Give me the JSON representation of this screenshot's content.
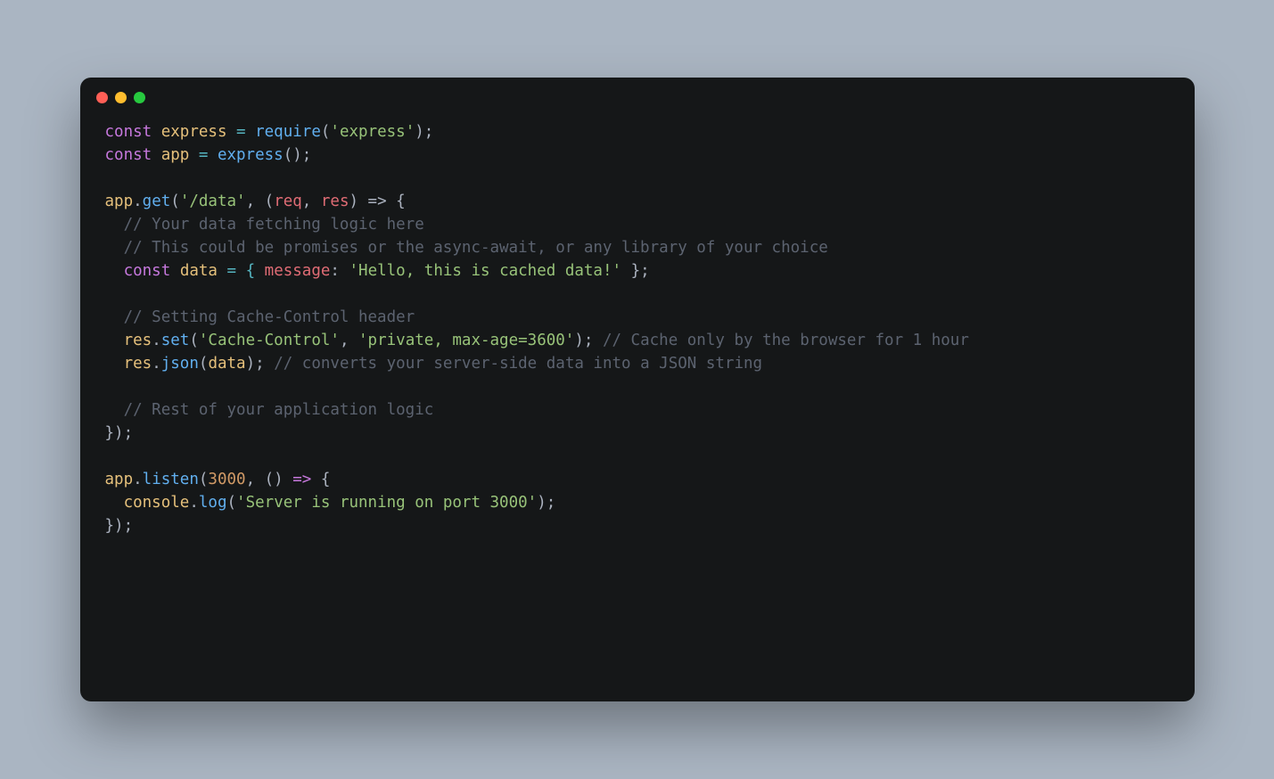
{
  "traffic_lights": {
    "red": "close",
    "yellow": "minimize",
    "green": "maximize"
  },
  "code": {
    "l1": {
      "kw": "const",
      "var": "express",
      "eq": " = ",
      "fn": "require",
      "open": "(",
      "str": "'express'",
      "close": ");"
    },
    "l2": {
      "kw": "const",
      "var": "app",
      "eq": " = ",
      "fn": "express",
      "call": "();"
    },
    "l3": "",
    "l4": {
      "obj": "app",
      "dot": ".",
      "fn": "get",
      "open": "(",
      "str": "'/data'",
      "comma": ", (",
      "p1": "req",
      "psep": ", ",
      "p2": "res",
      "arrow": ") => {"
    },
    "l5": {
      "indent": "  ",
      "cmt": "// Your data fetching logic here"
    },
    "l6": {
      "indent": "  ",
      "cmt": "// This could be promises or the async-await, or any library of your choice"
    },
    "l7": {
      "indent": "  ",
      "kw": "const",
      "var": "data",
      "eq": " = { ",
      "prop": "message",
      "colon": ": ",
      "str": "'Hello, this is cached data!'",
      "close": " };"
    },
    "l8": "",
    "l9": {
      "indent": "  ",
      "cmt": "// Setting Cache-Control header"
    },
    "l10": {
      "indent": "  ",
      "obj": "res",
      "dot": ".",
      "fn": "set",
      "open": "(",
      "str1": "'Cache-Control'",
      "sep": ", ",
      "str2": "'private, max-age=3600'",
      "close": "); ",
      "cmt": "// Cache only by the browser for 1 hour"
    },
    "l11": {
      "indent": "  ",
      "obj": "res",
      "dot": ".",
      "fn": "json",
      "open": "(",
      "arg": "data",
      "close": "); ",
      "cmt": "// converts your server-side data into a JSON string"
    },
    "l12": "",
    "l13": {
      "indent": "  ",
      "cmt": "// Rest of your application logic"
    },
    "l14": {
      "close": "});"
    },
    "l15": "",
    "l16": {
      "obj": "app",
      "dot": ".",
      "fn": "listen",
      "open": "(",
      "num": "3000",
      "sep": ", () ",
      "arrow": "=>",
      "brace": " {"
    },
    "l17": {
      "indent": "  ",
      "obj": "console",
      "dot": ".",
      "fn": "log",
      "open": "(",
      "str": "'Server is running on port 3000'",
      "close": ");"
    },
    "l18": {
      "close": "});"
    }
  }
}
